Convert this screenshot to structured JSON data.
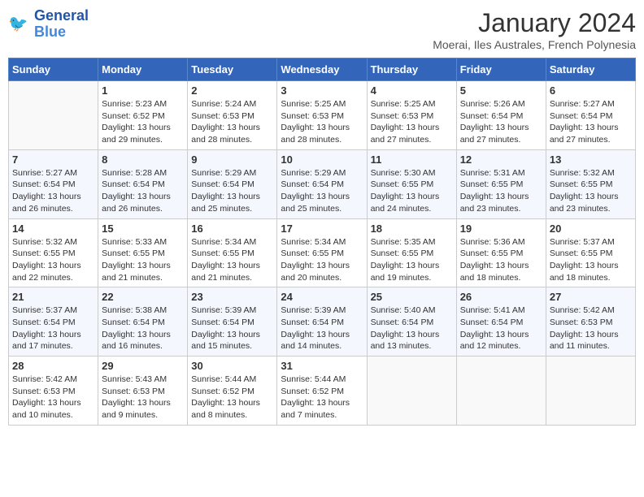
{
  "header": {
    "logo_line1": "General",
    "logo_line2": "Blue",
    "month": "January 2024",
    "location": "Moerai, Iles Australes, French Polynesia"
  },
  "weekdays": [
    "Sunday",
    "Monday",
    "Tuesday",
    "Wednesday",
    "Thursday",
    "Friday",
    "Saturday"
  ],
  "weeks": [
    [
      {
        "day": "",
        "info": ""
      },
      {
        "day": "1",
        "info": "Sunrise: 5:23 AM\nSunset: 6:52 PM\nDaylight: 13 hours\nand 29 minutes."
      },
      {
        "day": "2",
        "info": "Sunrise: 5:24 AM\nSunset: 6:53 PM\nDaylight: 13 hours\nand 28 minutes."
      },
      {
        "day": "3",
        "info": "Sunrise: 5:25 AM\nSunset: 6:53 PM\nDaylight: 13 hours\nand 28 minutes."
      },
      {
        "day": "4",
        "info": "Sunrise: 5:25 AM\nSunset: 6:53 PM\nDaylight: 13 hours\nand 27 minutes."
      },
      {
        "day": "5",
        "info": "Sunrise: 5:26 AM\nSunset: 6:54 PM\nDaylight: 13 hours\nand 27 minutes."
      },
      {
        "day": "6",
        "info": "Sunrise: 5:27 AM\nSunset: 6:54 PM\nDaylight: 13 hours\nand 27 minutes."
      }
    ],
    [
      {
        "day": "7",
        "info": "Sunrise: 5:27 AM\nSunset: 6:54 PM\nDaylight: 13 hours\nand 26 minutes."
      },
      {
        "day": "8",
        "info": "Sunrise: 5:28 AM\nSunset: 6:54 PM\nDaylight: 13 hours\nand 26 minutes."
      },
      {
        "day": "9",
        "info": "Sunrise: 5:29 AM\nSunset: 6:54 PM\nDaylight: 13 hours\nand 25 minutes."
      },
      {
        "day": "10",
        "info": "Sunrise: 5:29 AM\nSunset: 6:54 PM\nDaylight: 13 hours\nand 25 minutes."
      },
      {
        "day": "11",
        "info": "Sunrise: 5:30 AM\nSunset: 6:55 PM\nDaylight: 13 hours\nand 24 minutes."
      },
      {
        "day": "12",
        "info": "Sunrise: 5:31 AM\nSunset: 6:55 PM\nDaylight: 13 hours\nand 23 minutes."
      },
      {
        "day": "13",
        "info": "Sunrise: 5:32 AM\nSunset: 6:55 PM\nDaylight: 13 hours\nand 23 minutes."
      }
    ],
    [
      {
        "day": "14",
        "info": "Sunrise: 5:32 AM\nSunset: 6:55 PM\nDaylight: 13 hours\nand 22 minutes."
      },
      {
        "day": "15",
        "info": "Sunrise: 5:33 AM\nSunset: 6:55 PM\nDaylight: 13 hours\nand 21 minutes."
      },
      {
        "day": "16",
        "info": "Sunrise: 5:34 AM\nSunset: 6:55 PM\nDaylight: 13 hours\nand 21 minutes."
      },
      {
        "day": "17",
        "info": "Sunrise: 5:34 AM\nSunset: 6:55 PM\nDaylight: 13 hours\nand 20 minutes."
      },
      {
        "day": "18",
        "info": "Sunrise: 5:35 AM\nSunset: 6:55 PM\nDaylight: 13 hours\nand 19 minutes."
      },
      {
        "day": "19",
        "info": "Sunrise: 5:36 AM\nSunset: 6:55 PM\nDaylight: 13 hours\nand 18 minutes."
      },
      {
        "day": "20",
        "info": "Sunrise: 5:37 AM\nSunset: 6:55 PM\nDaylight: 13 hours\nand 18 minutes."
      }
    ],
    [
      {
        "day": "21",
        "info": "Sunrise: 5:37 AM\nSunset: 6:54 PM\nDaylight: 13 hours\nand 17 minutes."
      },
      {
        "day": "22",
        "info": "Sunrise: 5:38 AM\nSunset: 6:54 PM\nDaylight: 13 hours\nand 16 minutes."
      },
      {
        "day": "23",
        "info": "Sunrise: 5:39 AM\nSunset: 6:54 PM\nDaylight: 13 hours\nand 15 minutes."
      },
      {
        "day": "24",
        "info": "Sunrise: 5:39 AM\nSunset: 6:54 PM\nDaylight: 13 hours\nand 14 minutes."
      },
      {
        "day": "25",
        "info": "Sunrise: 5:40 AM\nSunset: 6:54 PM\nDaylight: 13 hours\nand 13 minutes."
      },
      {
        "day": "26",
        "info": "Sunrise: 5:41 AM\nSunset: 6:54 PM\nDaylight: 13 hours\nand 12 minutes."
      },
      {
        "day": "27",
        "info": "Sunrise: 5:42 AM\nSunset: 6:53 PM\nDaylight: 13 hours\nand 11 minutes."
      }
    ],
    [
      {
        "day": "28",
        "info": "Sunrise: 5:42 AM\nSunset: 6:53 PM\nDaylight: 13 hours\nand 10 minutes."
      },
      {
        "day": "29",
        "info": "Sunrise: 5:43 AM\nSunset: 6:53 PM\nDaylight: 13 hours\nand 9 minutes."
      },
      {
        "day": "30",
        "info": "Sunrise: 5:44 AM\nSunset: 6:52 PM\nDaylight: 13 hours\nand 8 minutes."
      },
      {
        "day": "31",
        "info": "Sunrise: 5:44 AM\nSunset: 6:52 PM\nDaylight: 13 hours\nand 7 minutes."
      },
      {
        "day": "",
        "info": ""
      },
      {
        "day": "",
        "info": ""
      },
      {
        "day": "",
        "info": ""
      }
    ]
  ]
}
